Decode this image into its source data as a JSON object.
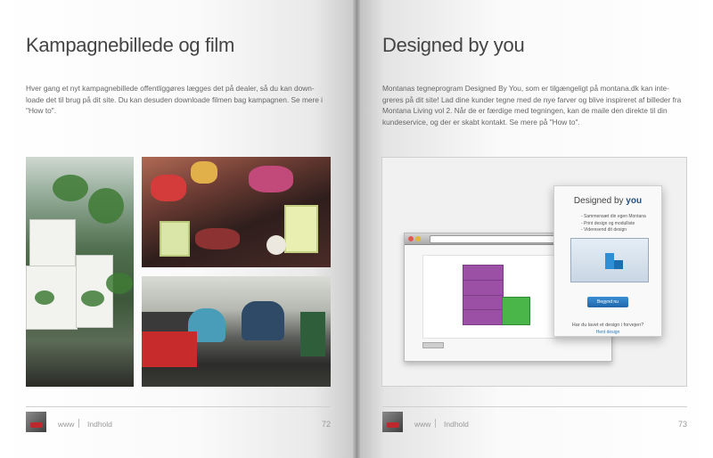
{
  "left_page": {
    "title": "Kampagnebillede og film",
    "body": "Hver gang et nyt kampagnebillede offentliggøres lægges det på dealer, så du kan down-loade det til brug på dit site. Du kan desuden downloade filmen bag kampagnen. Se mere i \"How to\".",
    "footer": {
      "www": "www",
      "link": "Indhold",
      "page_number": "72"
    }
  },
  "right_page": {
    "title": "Designed by you",
    "body": "Montanas tegneprogram Designed By You, som er tilgængeligt på montana.dk kan inte-greres på dit site! Lad dine kunder tegne med de nye farver og blive inspireret af billeder fra Montana Living vol 2. Når de er færdige med tegningen, kan de maile den direkte til din kundeservice, og der er skabt kontakt. Se mere på \"How to\".",
    "screenshot": {
      "card_title_prefix": "Designed by ",
      "card_title_bold": "you",
      "card_items": [
        "- Sammensæt din egen Montana",
        "- Print design og modulliste",
        "- Videresend dit design"
      ],
      "button": "Begynd nu",
      "question": "Har du lavet et design i forvejen?",
      "link": "Hent design"
    },
    "footer": {
      "www": "www",
      "link": "Indhold",
      "page_number": "73"
    }
  },
  "colors": {
    "purple_cabinet": "#9b4fa5",
    "green_cabinet": "#4ab64a",
    "button_blue": "#1f66a8"
  }
}
